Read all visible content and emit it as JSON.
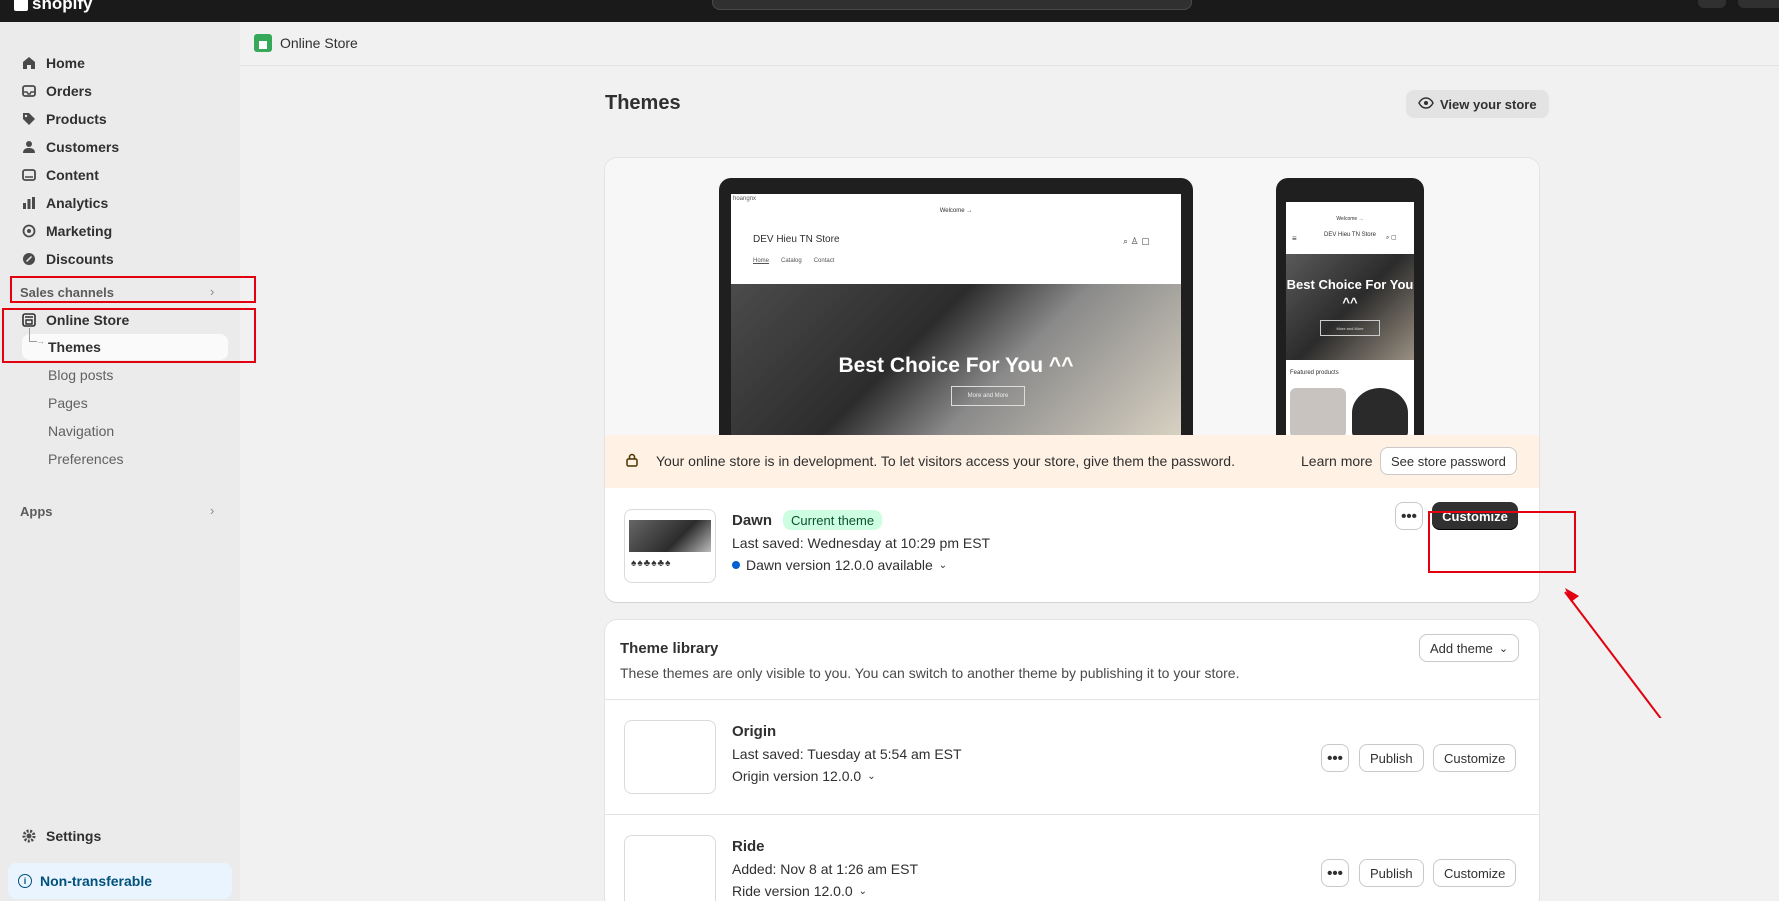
{
  "topbar": {
    "logo": "shopify"
  },
  "sidebar": {
    "nav": [
      {
        "label": "Home",
        "icon": "home-icon"
      },
      {
        "label": "Orders",
        "icon": "inbox-icon"
      },
      {
        "label": "Products",
        "icon": "tag-icon"
      },
      {
        "label": "Customers",
        "icon": "person-icon"
      },
      {
        "label": "Content",
        "icon": "image-icon"
      },
      {
        "label": "Analytics",
        "icon": "bar-chart-icon"
      },
      {
        "label": "Marketing",
        "icon": "target-icon"
      },
      {
        "label": "Discounts",
        "icon": "discount-icon"
      }
    ],
    "sales_channels_label": "Sales channels",
    "online_store_label": "Online Store",
    "themes_label": "Themes",
    "sub_items": [
      "Blog posts",
      "Pages",
      "Navigation",
      "Preferences"
    ],
    "apps_label": "Apps",
    "settings_label": "Settings",
    "non_transferable": "Non-transferable"
  },
  "header": {
    "breadcrumb": "Online Store"
  },
  "page": {
    "title": "Themes",
    "view_store": "View your store"
  },
  "preview": {
    "laptop": {
      "tiny": "hoangnx",
      "welcome": "Welcome →",
      "store_name": "DEV Hieu TN Store",
      "nav": [
        "Home",
        "Catalog",
        "Contact"
      ],
      "hero_title": "Best Choice For You ^^",
      "hero_button": "More and More"
    },
    "phone": {
      "welcome": "Welcome →",
      "store_name": "DEV Hieu TN Store",
      "hero_title": "Best Choice For You ^^",
      "hero_button": "More and More",
      "featured": "Featured products"
    }
  },
  "banner": {
    "text": "Your online store is in development. To let visitors access your store, give them the password.",
    "learn_more": "Learn more",
    "see_password": "See store password"
  },
  "current_theme": {
    "name": "Dawn",
    "badge": "Current theme",
    "last_saved": "Last saved: Wednesday at 10:29 pm EST",
    "version": "Dawn version 12.0.0 available",
    "more": "•••",
    "customize": "Customize"
  },
  "library": {
    "title": "Theme library",
    "description": "These themes are only visible to you. You can switch to another theme by publishing it to your store.",
    "add_theme": "Add theme",
    "themes": [
      {
        "name": "Origin",
        "meta": "Last saved: Tuesday at 5:54 am EST",
        "version": "Origin version 12.0.0",
        "publish": "Publish",
        "customize": "Customize",
        "more": "•••"
      },
      {
        "name": "Ride",
        "meta": "Added: Nov 8 at 1:26 am EST",
        "version": "Ride version 12.0.0",
        "publish": "Publish",
        "customize": "Customize",
        "more": "•••"
      }
    ]
  },
  "colors": {
    "annotation_red": "#e3000f",
    "dark_button": "#303030",
    "banner_bg": "#fff1e3",
    "badge_bg": "#cdfee1"
  }
}
